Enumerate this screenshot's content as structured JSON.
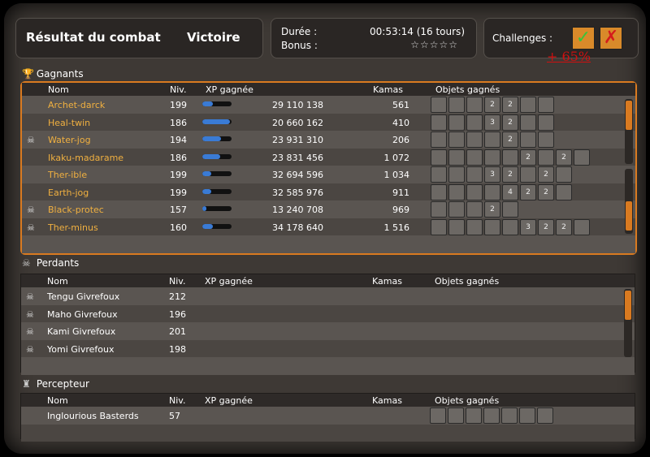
{
  "header": {
    "title": "Résultat du combat",
    "result": "Victoire"
  },
  "info": {
    "duration_label": "Durée :",
    "duration_value": "00:53:14 (16 tours)",
    "bonus_label": "Bonus :",
    "bonus_stars": "☆☆☆☆☆"
  },
  "challenges": {
    "label": "Challenges :",
    "bonus_text": "+ 65%"
  },
  "columns": {
    "name": "Nom",
    "level": "Niv.",
    "xp": "XP gagnée",
    "kamas": "Kamas",
    "items": "Objets gagnés"
  },
  "sections": {
    "winners": "Gagnants",
    "losers": "Perdants",
    "collector": "Percepteur"
  },
  "winners": [
    {
      "name": "Archet-darck",
      "level": "199",
      "xp": "29 110 138",
      "xp_fraction": 0.35,
      "kamas": "561",
      "dead": false,
      "items": [
        "",
        "",
        "",
        "2",
        "2",
        "",
        ""
      ]
    },
    {
      "name": "Heal-twin",
      "level": "186",
      "xp": "20 660 162",
      "xp_fraction": 0.95,
      "kamas": "410",
      "dead": false,
      "items": [
        "",
        "",
        "",
        "3",
        "2",
        "",
        ""
      ]
    },
    {
      "name": "Water-jog",
      "level": "194",
      "xp": "23 931 310",
      "xp_fraction": 0.65,
      "kamas": "206",
      "dead": true,
      "items": [
        "",
        "",
        "",
        "",
        "2",
        "",
        ""
      ]
    },
    {
      "name": "Ikaku-madarame",
      "level": "186",
      "xp": "23 831 456",
      "xp_fraction": 0.6,
      "kamas": "1 072",
      "dead": false,
      "items": [
        "",
        "",
        "",
        "",
        "",
        "2",
        "",
        "2",
        ""
      ]
    },
    {
      "name": "Ther-ible",
      "level": "199",
      "xp": "32 694 596",
      "xp_fraction": 0.3,
      "kamas": "1 034",
      "dead": false,
      "items": [
        "",
        "",
        "",
        "3",
        "2",
        "",
        "2",
        ""
      ]
    },
    {
      "name": "Earth-jog",
      "level": "199",
      "xp": "32 585 976",
      "xp_fraction": 0.3,
      "kamas": "911",
      "dead": false,
      "items": [
        "",
        "",
        "",
        "",
        "4",
        "2",
        "2",
        ""
      ]
    },
    {
      "name": "Black-protec",
      "level": "157",
      "xp": "13 240 708",
      "xp_fraction": 0.15,
      "kamas": "969",
      "dead": true,
      "items": [
        "",
        "",
        "",
        "2",
        ""
      ]
    },
    {
      "name": "Ther-minus",
      "level": "160",
      "xp": "34 178 640",
      "xp_fraction": 0.35,
      "kamas": "1 516",
      "dead": true,
      "items": [
        "",
        "",
        "",
        "",
        "",
        "3",
        "2",
        "2",
        ""
      ]
    }
  ],
  "losers": [
    {
      "name": "Tengu Givrefoux",
      "level": "212"
    },
    {
      "name": "Maho Givrefoux",
      "level": "196"
    },
    {
      "name": "Kami Givrefoux",
      "level": "201"
    },
    {
      "name": "Yomi Givrefoux",
      "level": "198"
    }
  ],
  "collector": [
    {
      "name": "Inglourious Basterds",
      "level": "57",
      "items": [
        "",
        "",
        "",
        "",
        "",
        "",
        ""
      ]
    }
  ]
}
